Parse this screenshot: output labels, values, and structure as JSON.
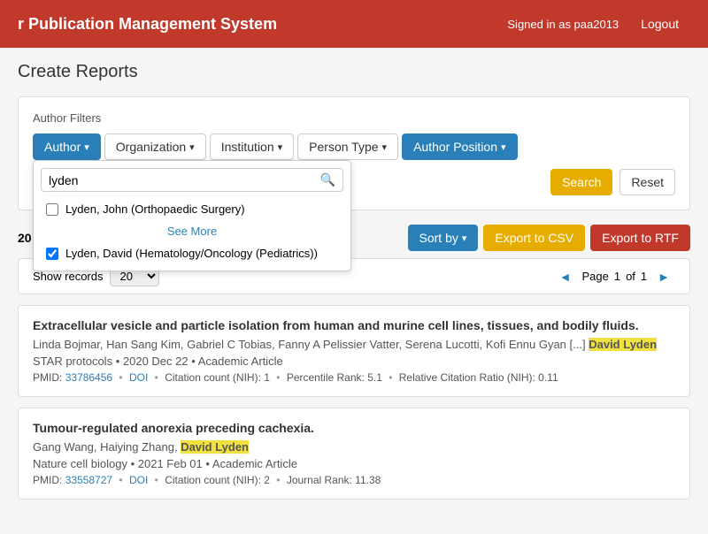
{
  "header": {
    "title": "r Publication Management System",
    "signed_in_as": "Signed in as paa2013",
    "logout_label": "Logout"
  },
  "page": {
    "title": "Create Reports"
  },
  "filters": {
    "section_label": "Author Filters",
    "buttons": [
      {
        "label": "Author",
        "type": "primary",
        "has_caret": true
      },
      {
        "label": "Organization",
        "type": "secondary",
        "has_caret": true
      },
      {
        "label": "Institution",
        "type": "secondary",
        "has_caret": true
      },
      {
        "label": "Person Type",
        "type": "secondary",
        "has_caret": true
      },
      {
        "label": "Author Position",
        "type": "primary",
        "has_caret": true
      }
    ],
    "author_search_placeholder": "",
    "author_search_value": "lyden",
    "dropdown_items": [
      {
        "id": "lyden-john",
        "label": "Lyden, John (Orthopaedic Surgery)",
        "checked": false
      },
      {
        "id": "lyden-david",
        "label": "Lyden, David (Hematology/Oncology (Pediatrics))",
        "checked": true
      }
    ],
    "see_more_label": "See More",
    "search_button": "Search",
    "reset_button": "Reset"
  },
  "results": {
    "count_label": "20 articles",
    "sort_label": "Sort by",
    "export_csv_label": "Export to CSV",
    "export_rtf_label": "Export to RTF"
  },
  "pagination": {
    "show_records_label": "Show records",
    "show_count": "20",
    "page_label": "Page",
    "current_page": "1",
    "total_pages": "1",
    "prev_icon": "◄",
    "next_icon": "►"
  },
  "articles": [
    {
      "title": "Extracellular vesicle and particle isolation from human and murine cell lines, tissues, and bodily fluids.",
      "authors_prefix": "Linda Bojmar, Han Sang Kim, Gabriel C Tobias, Fanny A Pelissier Vatter, Serena Lucotti, Kofi Ennu Gyan",
      "authors_truncated": "[...]",
      "authors_highlighted": "David Lyden",
      "journal": "STAR protocols",
      "year": "2020 Dec 22",
      "type": "Academic Article",
      "pmid_label": "PMID:",
      "pmid": "33786456",
      "doi": "DOI",
      "citation_count": "Citation count (NIH): 1",
      "percentile_rank": "Percentile Rank: 5.1",
      "relative_citation": "Relative Citation Ratio (NIH): 0.11"
    },
    {
      "title": "Tumour-regulated anorexia preceding cachexia.",
      "authors_prefix": "Gang Wang, Haiying Zhang,",
      "authors_truncated": "",
      "authors_highlighted": "David Lyden",
      "journal": "Nature cell biology",
      "year": "2021 Feb 01",
      "type": "Academic Article",
      "pmid_label": "PMID:",
      "pmid": "33558727",
      "doi": "DOI",
      "citation_count": "Citation count (NIH): 2",
      "percentile_rank": "",
      "relative_citation": "Journal Rank: 11.38"
    }
  ]
}
